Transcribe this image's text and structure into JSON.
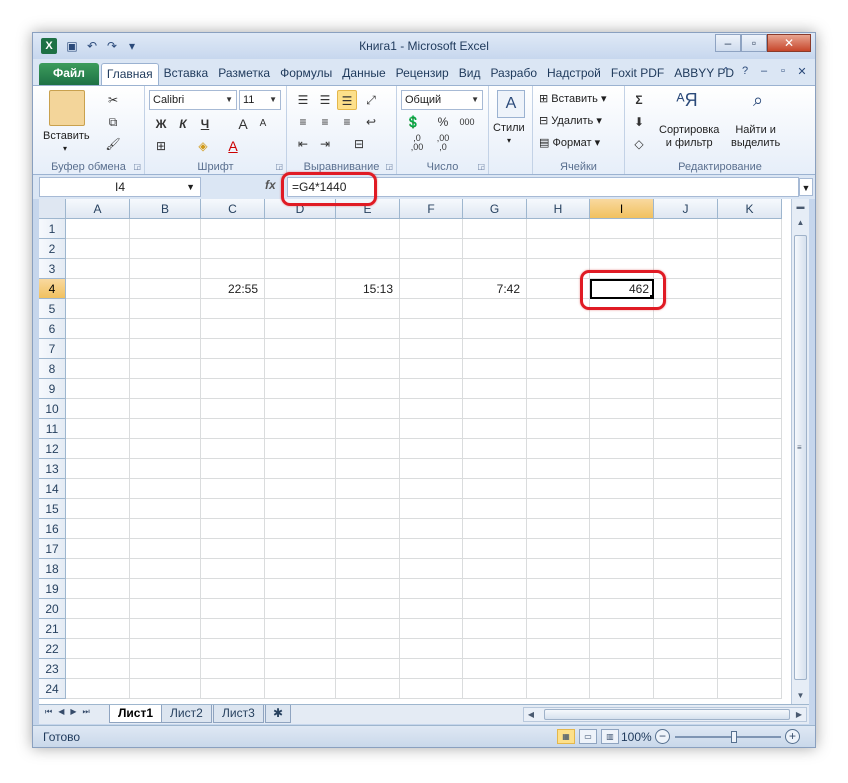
{
  "window": {
    "title": "Книга1  -  Microsoft Excel",
    "qat": [
      "save-icon",
      "undo-icon",
      "redo-icon"
    ],
    "controls": {
      "minimize": "–",
      "restore": "▫",
      "close": "✕"
    }
  },
  "tabs": [
    "Файл",
    "Главная",
    "Вставка",
    "Разметка",
    "Формулы",
    "Данные",
    "Рецензир",
    "Вид",
    "Разрабо",
    "Надстрой",
    "Foxit PDF",
    "ABBYY PD"
  ],
  "active_tab": "Главная",
  "ribbon": {
    "clipboard": {
      "paste_label": "Вставить",
      "group_label": "Буфер обмена"
    },
    "font": {
      "name": "Calibri",
      "size": "11",
      "bold": "Ж",
      "italic": "К",
      "underline": "Ч",
      "grow": "A",
      "shrink": "A",
      "color_a": "A",
      "group_label": "Шрифт"
    },
    "alignment": {
      "group_label": "Выравнивание"
    },
    "number": {
      "format": "Общий",
      "percent": "%",
      "thousands": "000",
      "dec_inc": ",0\n,00",
      "dec_dec": ",00\n,0",
      "group_label": "Число"
    },
    "styles": {
      "label": "Стили"
    },
    "cells": {
      "insert": "Вставить",
      "delete": "Удалить",
      "format": "Формат",
      "group_label": "Ячейки"
    },
    "editing": {
      "sigma": "Σ",
      "sort": "Сортировка\nи фильтр",
      "find": "Найти и\nвыделить",
      "group_label": "Редактирование"
    }
  },
  "formula_bar": {
    "name_box": "I4",
    "fx": "fx",
    "formula": "=G4*1440"
  },
  "columns": [
    {
      "label": "A",
      "sel": false
    },
    {
      "label": "B",
      "sel": false
    },
    {
      "label": "C",
      "sel": false
    },
    {
      "label": "D",
      "sel": false
    },
    {
      "label": "E",
      "sel": false
    },
    {
      "label": "F",
      "sel": false
    },
    {
      "label": "G",
      "sel": false
    },
    {
      "label": "H",
      "sel": false
    },
    {
      "label": "I",
      "sel": true
    },
    {
      "label": "J",
      "sel": false
    },
    {
      "label": "K",
      "sel": false
    }
  ],
  "rows": [
    {
      "n": "1",
      "cells": [
        "",
        "",
        "",
        "",
        "",
        "",
        "",
        "",
        "",
        "",
        ""
      ]
    },
    {
      "n": "2",
      "cells": [
        "",
        "",
        "",
        "",
        "",
        "",
        "",
        "",
        "",
        "",
        ""
      ]
    },
    {
      "n": "3",
      "cells": [
        "",
        "",
        "",
        "",
        "",
        "",
        "",
        "",
        "",
        "",
        ""
      ]
    },
    {
      "n": "4",
      "cells": [
        "",
        "",
        "22:55",
        "",
        "15:13",
        "",
        "7:42",
        "",
        "462",
        "",
        ""
      ],
      "active_col": 8
    },
    {
      "n": "5",
      "cells": [
        "",
        "",
        "",
        "",
        "",
        "",
        "",
        "",
        "",
        "",
        ""
      ]
    },
    {
      "n": "6",
      "cells": [
        "",
        "",
        "",
        "",
        "",
        "",
        "",
        "",
        "",
        "",
        ""
      ]
    },
    {
      "n": "7",
      "cells": [
        "",
        "",
        "",
        "",
        "",
        "",
        "",
        "",
        "",
        "",
        ""
      ]
    },
    {
      "n": "8",
      "cells": [
        "",
        "",
        "",
        "",
        "",
        "",
        "",
        "",
        "",
        "",
        ""
      ]
    },
    {
      "n": "9",
      "cells": [
        "",
        "",
        "",
        "",
        "",
        "",
        "",
        "",
        "",
        "",
        ""
      ]
    },
    {
      "n": "10",
      "cells": [
        "",
        "",
        "",
        "",
        "",
        "",
        "",
        "",
        "",
        "",
        ""
      ]
    },
    {
      "n": "11",
      "cells": [
        "",
        "",
        "",
        "",
        "",
        "",
        "",
        "",
        "",
        "",
        ""
      ]
    },
    {
      "n": "12",
      "cells": [
        "",
        "",
        "",
        "",
        "",
        "",
        "",
        "",
        "",
        "",
        ""
      ]
    },
    {
      "n": "13",
      "cells": [
        "",
        "",
        "",
        "",
        "",
        "",
        "",
        "",
        "",
        "",
        ""
      ]
    },
    {
      "n": "14",
      "cells": [
        "",
        "",
        "",
        "",
        "",
        "",
        "",
        "",
        "",
        "",
        ""
      ]
    },
    {
      "n": "15",
      "cells": [
        "",
        "",
        "",
        "",
        "",
        "",
        "",
        "",
        "",
        "",
        ""
      ]
    },
    {
      "n": "16",
      "cells": [
        "",
        "",
        "",
        "",
        "",
        "",
        "",
        "",
        "",
        "",
        ""
      ]
    },
    {
      "n": "17",
      "cells": [
        "",
        "",
        "",
        "",
        "",
        "",
        "",
        "",
        "",
        "",
        ""
      ]
    },
    {
      "n": "18",
      "cells": [
        "",
        "",
        "",
        "",
        "",
        "",
        "",
        "",
        "",
        "",
        ""
      ]
    },
    {
      "n": "19",
      "cells": [
        "",
        "",
        "",
        "",
        "",
        "",
        "",
        "",
        "",
        "",
        ""
      ]
    },
    {
      "n": "20",
      "cells": [
        "",
        "",
        "",
        "",
        "",
        "",
        "",
        "",
        "",
        "",
        ""
      ]
    },
    {
      "n": "21",
      "cells": [
        "",
        "",
        "",
        "",
        "",
        "",
        "",
        "",
        "",
        "",
        ""
      ]
    },
    {
      "n": "22",
      "cells": [
        "",
        "",
        "",
        "",
        "",
        "",
        "",
        "",
        "",
        "",
        ""
      ]
    },
    {
      "n": "23",
      "cells": [
        "",
        "",
        "",
        "",
        "",
        "",
        "",
        "",
        "",
        "",
        ""
      ]
    },
    {
      "n": "24",
      "cells": [
        "",
        "",
        "",
        "",
        "",
        "",
        "",
        "",
        "",
        "",
        ""
      ]
    }
  ],
  "sheets": [
    "Лист1",
    "Лист2",
    "Лист3"
  ],
  "active_sheet": "Лист1",
  "status": {
    "ready": "Готово",
    "zoom": "100%"
  },
  "colors": {
    "accent": "#1e7145",
    "annotation": "#e01b24",
    "selected_header": "#f1c15f"
  }
}
